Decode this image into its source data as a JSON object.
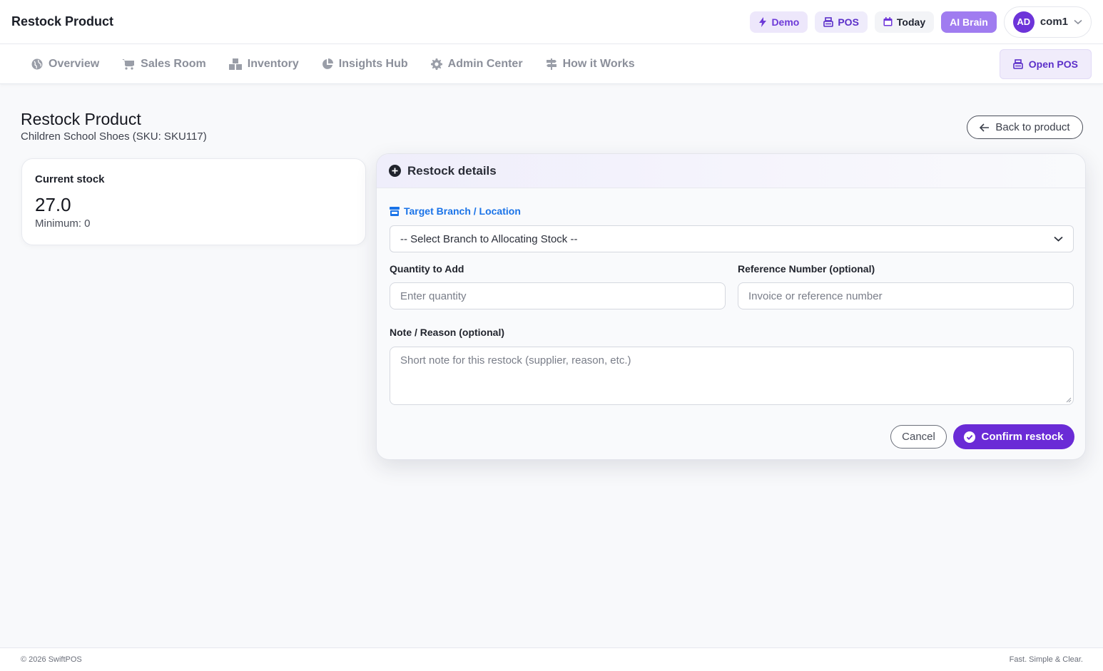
{
  "header": {
    "title": "Restock Product",
    "demo_label": "Demo",
    "pos_label": "POS",
    "today_label": "Today",
    "ai_label": "AI Brain",
    "user_initials": "AD",
    "user_name": "com1"
  },
  "nav": {
    "items": [
      {
        "label": "Overview",
        "icon": "globe-icon"
      },
      {
        "label": "Sales Room",
        "icon": "cart-icon"
      },
      {
        "label": "Inventory",
        "icon": "boxes-icon"
      },
      {
        "label": "Insights Hub",
        "icon": "pie-chart-icon"
      },
      {
        "label": "Admin Center",
        "icon": "gear-icon"
      },
      {
        "label": "How it Works",
        "icon": "signpost-icon"
      }
    ],
    "open_pos_label": "Open POS"
  },
  "page": {
    "title": "Restock Product",
    "subtitle": "Children School Shoes (SKU: SKU117)",
    "back_label": "Back to product"
  },
  "stock": {
    "label": "Current stock",
    "value": "27.0",
    "minimum": "Minimum: 0"
  },
  "form": {
    "title": "Restock details",
    "branch_label": "Target Branch / Location",
    "branch_selected": "-- Select Branch to Allocating Stock --",
    "quantity_label": "Quantity to Add",
    "quantity_placeholder": "Enter quantity",
    "reference_label": "Reference Number (optional)",
    "reference_placeholder": "Invoice or reference number",
    "note_label": "Note / Reason (optional)",
    "note_placeholder": "Short note for this restock (supplier, reason, etc.)",
    "cancel_label": "Cancel",
    "confirm_label": "Confirm restock"
  },
  "footer": {
    "copyright": "© 2026 SwiftPOS",
    "tagline": "Fast. Simple & Clear."
  },
  "colors": {
    "accent": "#6a2bd6",
    "link_blue": "#1a73e8",
    "ai_button": "#a07cf0"
  }
}
